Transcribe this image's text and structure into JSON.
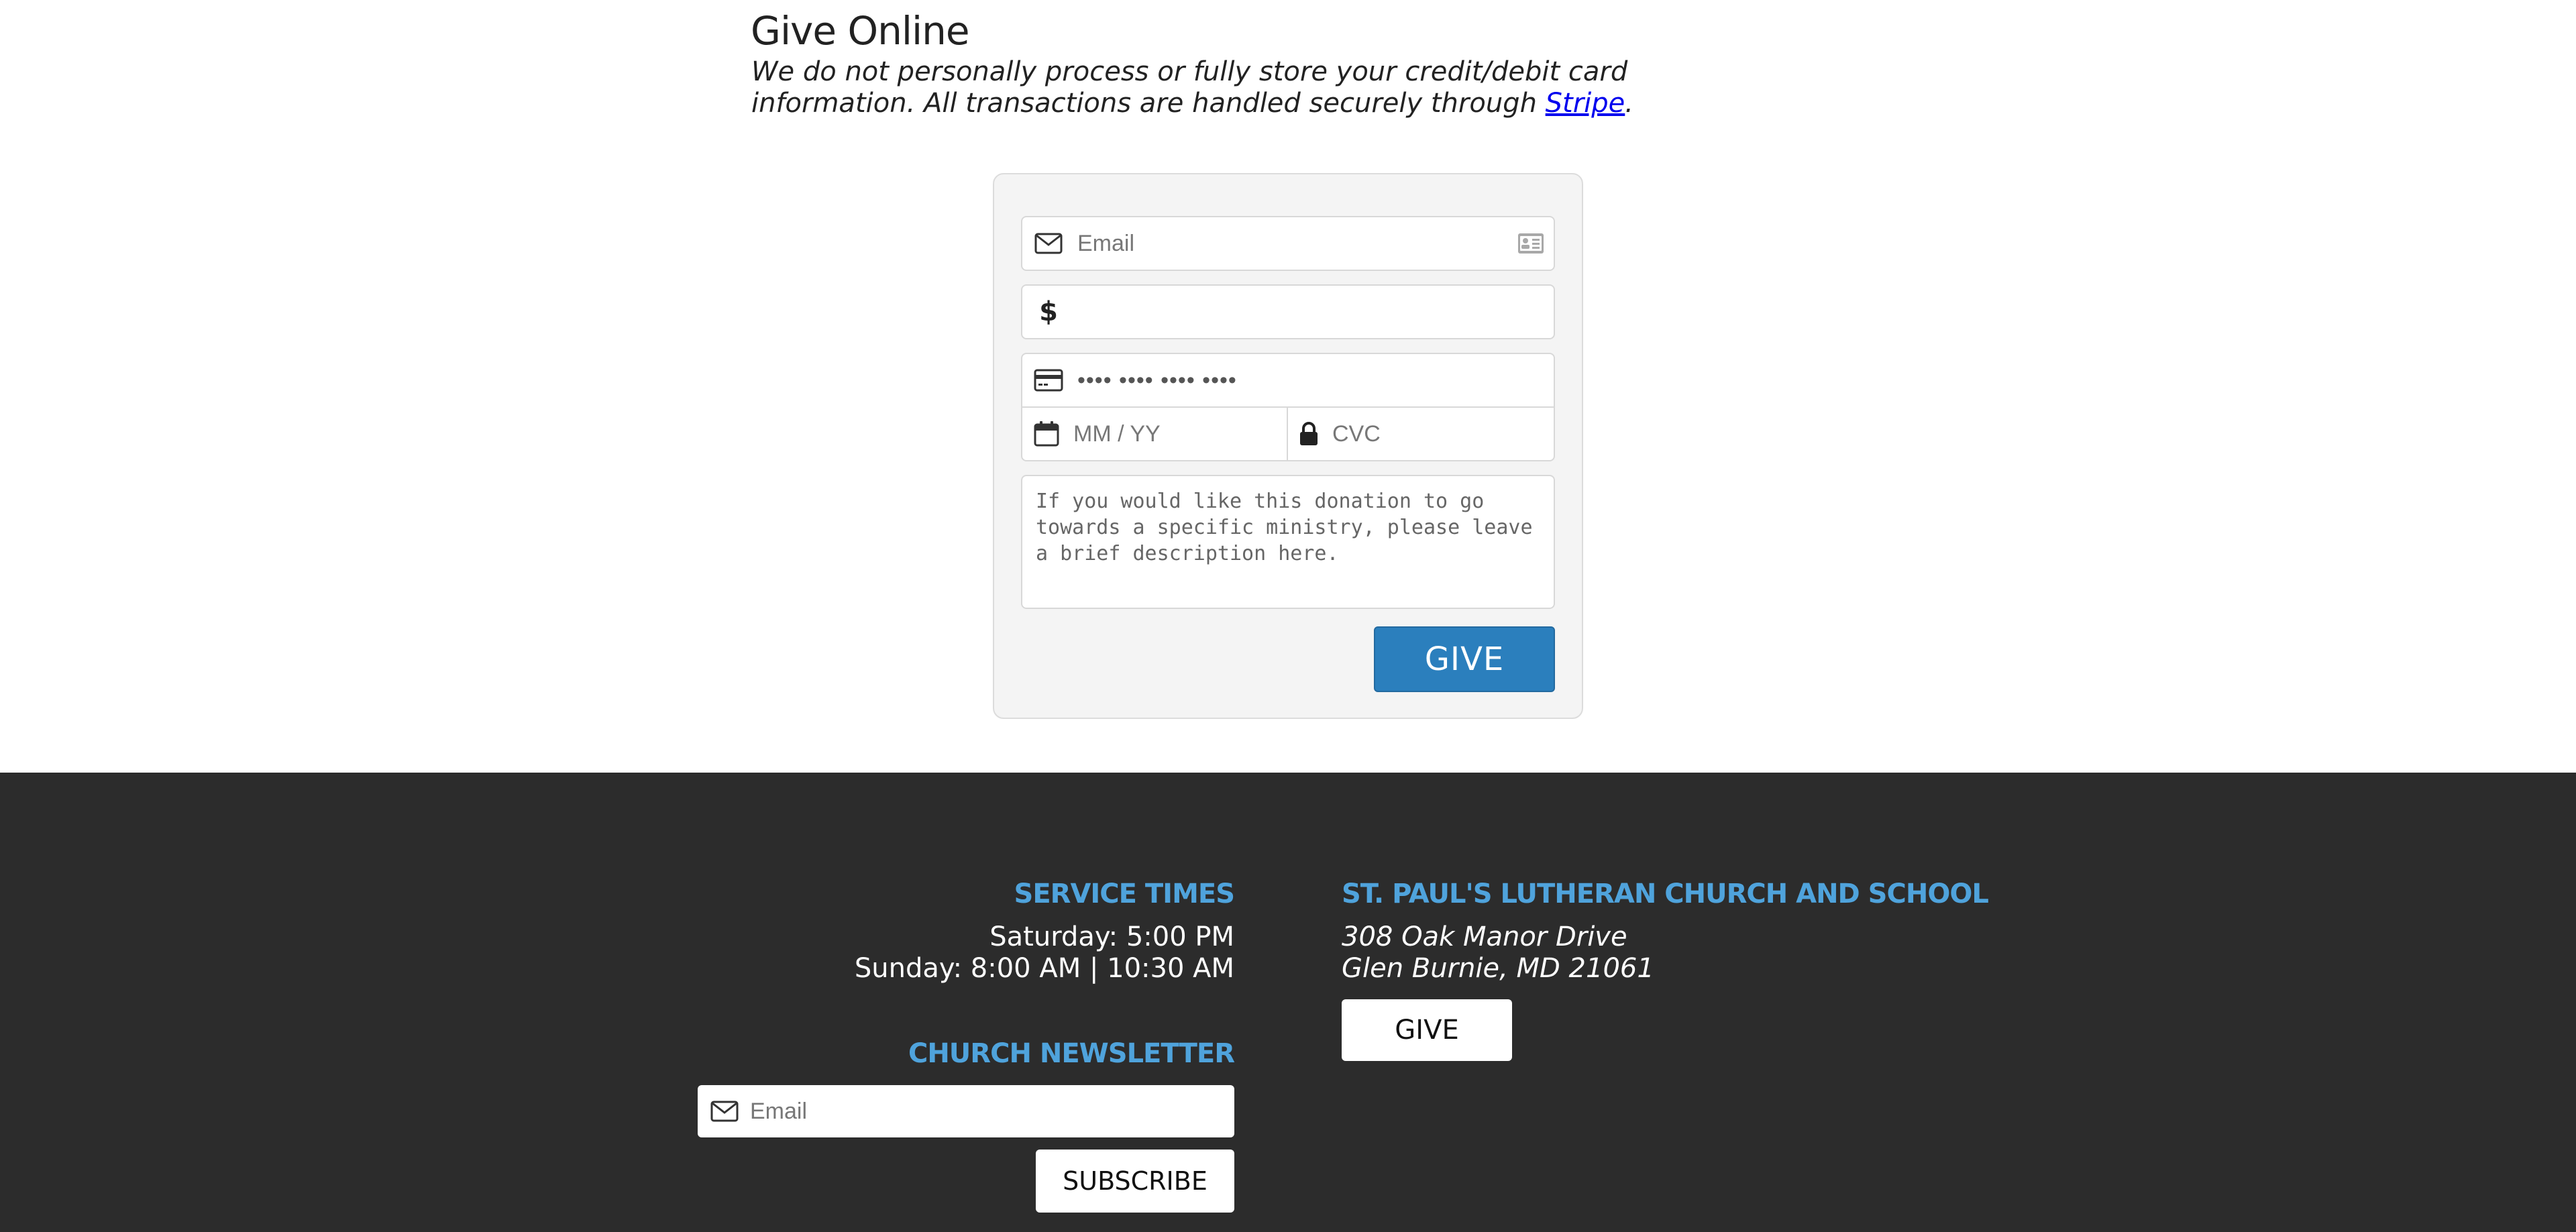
{
  "give_online": {
    "title": "Give Online",
    "intro_before_link": "We do not personally process or fully store your credit/debit card information. All transactions are handled securely through ",
    "link_text": "Stripe",
    "intro_after_link": "."
  },
  "form": {
    "email_placeholder": "Email",
    "amount_symbol": "$",
    "amount_value": "",
    "card_number_placeholder": "•••• •••• •••• ••••",
    "expiry_placeholder": "MM / YY",
    "cvc_placeholder": "CVC",
    "note_placeholder": "If you would like this donation to go towards a specific ministry, please leave a brief description here.",
    "give_label": "GIVE",
    "icons": {
      "email": "envelope-icon",
      "contact": "contact-card-icon",
      "card": "credit-card-icon",
      "expiry": "calendar-icon",
      "cvc": "lock-icon"
    }
  },
  "footer": {
    "service_heading": "SERVICE TIMES",
    "service_saturday": "Saturday: 5:00 PM",
    "service_sunday": "Sunday: 8:00 AM | 10:30 AM",
    "newsletter_heading": "CHURCH NEWSLETTER",
    "newsletter_placeholder": "Email",
    "subscribe_label": "SUBSCRIBE",
    "church_heading": "ST. PAUL'S LUTHERAN CHURCH AND SCHOOL",
    "address_line1": "308 Oak Manor Drive",
    "address_line2": "Glen Burnie, MD 21061",
    "give_label": "GIVE"
  },
  "colors": {
    "accent_blue": "#2b7fbd",
    "footer_heading": "#4fa3dc",
    "footer_bg": "#2c2c2c",
    "form_bg": "#f4f4f4"
  }
}
